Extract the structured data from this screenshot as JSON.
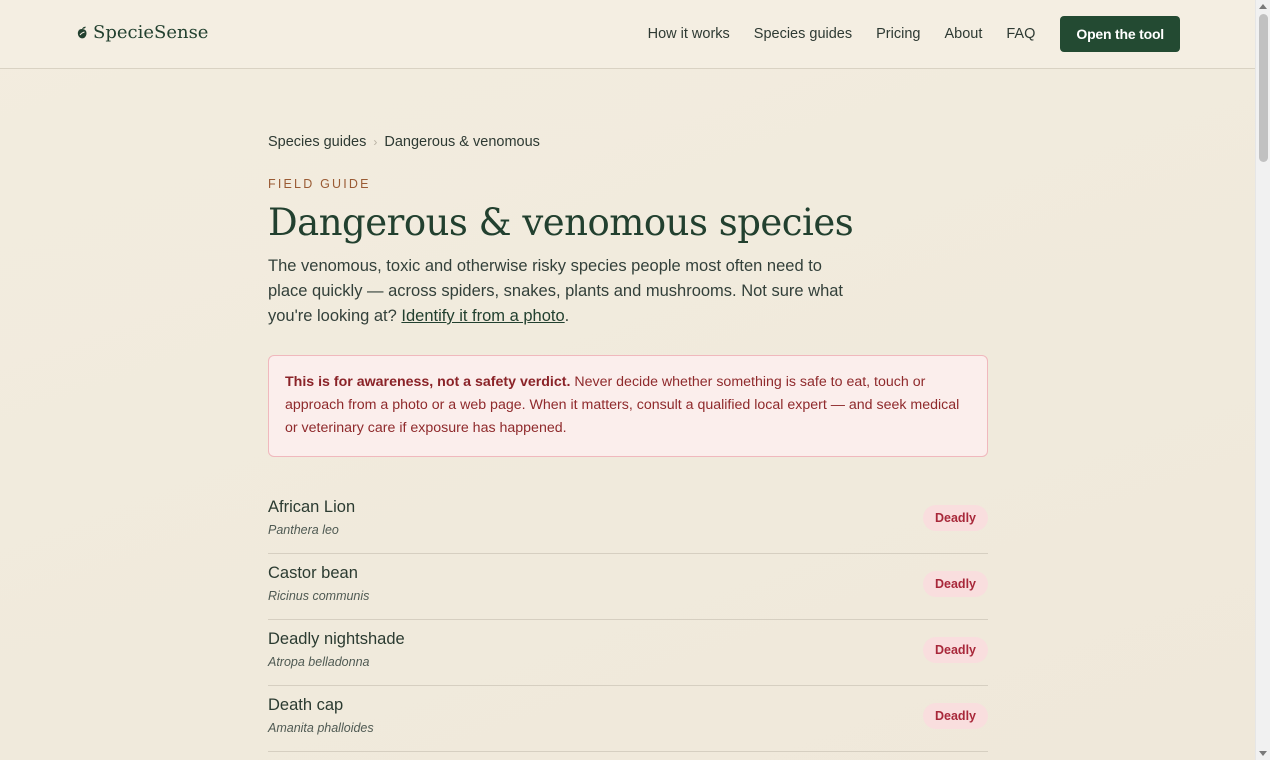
{
  "brand": {
    "name": "SpecieSense"
  },
  "nav": {
    "items": [
      {
        "label": "How it works"
      },
      {
        "label": "Species guides"
      },
      {
        "label": "Pricing"
      },
      {
        "label": "About"
      },
      {
        "label": "FAQ"
      }
    ],
    "cta_label": "Open the tool"
  },
  "breadcrumb": {
    "parent": "Species guides",
    "current": "Dangerous & venomous"
  },
  "eyebrow": "FIELD GUIDE",
  "title": "Dangerous & venomous species",
  "lede": {
    "text": "The venomous, toxic and otherwise risky species people most often need to place quickly — across spiders, snakes, plants and mushrooms. Not sure what you're looking at? ",
    "link": "Identify it from a photo",
    "end": "."
  },
  "warning": {
    "strong": "This is for awareness, not a safety verdict.",
    "text": " Never decide whether something is safe to eat, touch or approach from a photo or a web page. When it matters, consult a qualified local expert — and seek medical or veterinary care if exposure has happened."
  },
  "species": [
    {
      "name": "African Lion",
      "scientific": "Panthera leo",
      "badge": "Deadly"
    },
    {
      "name": "Castor bean",
      "scientific": "Ricinus communis",
      "badge": "Deadly"
    },
    {
      "name": "Deadly nightshade",
      "scientific": "Atropa belladonna",
      "badge": "Deadly"
    },
    {
      "name": "Death cap",
      "scientific": "Amanita phalloides",
      "badge": "Deadly"
    }
  ],
  "colors": {
    "brand_green": "#234a32",
    "danger_text": "#a8283a",
    "danger_bg": "#f9dede",
    "background": "#f3ede0"
  },
  "icons": {
    "logo": "leaf-icon"
  }
}
